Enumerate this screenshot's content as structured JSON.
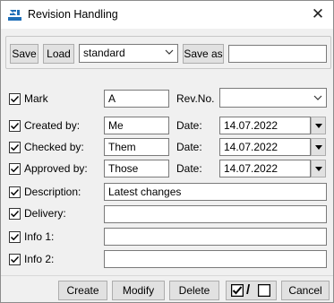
{
  "window": {
    "title": "Revision Handling"
  },
  "toolbar": {
    "save_label": "Save",
    "load_label": "Load",
    "profile_value": "standard",
    "save_as_label": "Save as",
    "save_as_value": ""
  },
  "fields": {
    "mark": {
      "label": "Mark",
      "value": "A",
      "checked": true
    },
    "rev_no": {
      "label": "Rev.No.",
      "value": ""
    },
    "created_by": {
      "label": "Created by:",
      "value": "Me",
      "checked": true
    },
    "checked_by": {
      "label": "Checked by:",
      "value": "Them",
      "checked": true
    },
    "approved_by": {
      "label": "Approved by:",
      "value": "Those",
      "checked": true
    },
    "date_label": "Date:",
    "created_date": "14.07.2022",
    "checked_date": "14.07.2022",
    "approved_date": "14.07.2022",
    "description": {
      "label": "Description:",
      "value": "Latest changes",
      "checked": true
    },
    "delivery": {
      "label": "Delivery:",
      "value": "",
      "checked": true
    },
    "info1": {
      "label": "Info 1:",
      "value": "",
      "checked": true
    },
    "info2": {
      "label": "Info 2:",
      "value": "",
      "checked": true
    }
  },
  "footer": {
    "create_label": "Create",
    "modify_label": "Modify",
    "delete_label": "Delete",
    "cancel_label": "Cancel",
    "toggle_separator": "/"
  },
  "colors": {
    "title_bg": "#ffffff",
    "window_bg": "#f0f0f0",
    "button_bg": "#e1e1e1",
    "icon_blue": "#1f6fb8"
  }
}
